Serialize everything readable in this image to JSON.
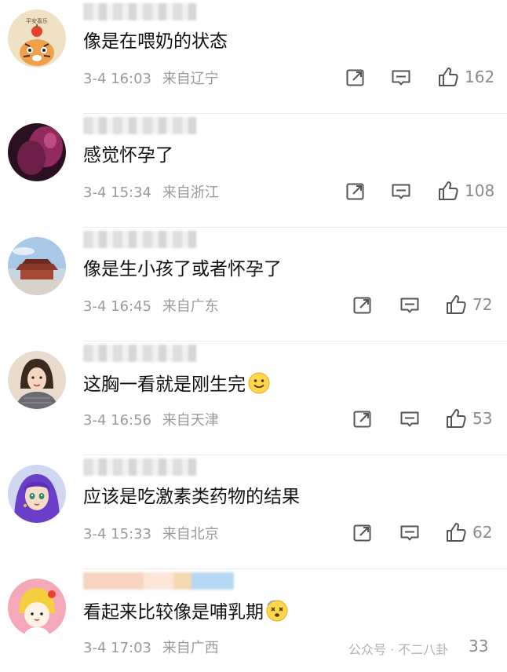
{
  "comments": [
    {
      "text": "像是在喂奶的状态",
      "date": "3-4",
      "time": "16:03",
      "location": "来自辽宁",
      "likes": "162",
      "avatar": "tiger-avatar"
    },
    {
      "text": "感觉怀孕了",
      "date": "3-4",
      "time": "15:34",
      "location": "来自浙江",
      "likes": "108",
      "avatar": "purple-avatar"
    },
    {
      "text": "像是生小孩了或者怀孕了",
      "date": "3-4",
      "time": "16:45",
      "location": "来自广东",
      "likes": "72",
      "avatar": "palace-avatar"
    },
    {
      "text": "这胸一看就是刚生完",
      "date": "3-4",
      "time": "16:56",
      "location": "来自天津",
      "likes": "53",
      "avatar": "woman-avatar",
      "emoji": "slightly-smiling-emoji"
    },
    {
      "text": "应该是吃激素类药物的结果",
      "date": "3-4",
      "time": "15:33",
      "location": "来自北京",
      "likes": "62",
      "avatar": "anime-girl-avatar"
    },
    {
      "text": "看起来比较像是哺乳期",
      "date": "3-4",
      "time": "17:03",
      "location": "来自广西",
      "likes": "33",
      "avatar": "cartoon-kid-avatar",
      "emoji": "dizzy-face-emoji"
    }
  ],
  "avatar_text": {
    "tiger_caption": "平安喜乐"
  },
  "watermark": "公众号 · 不二八卦",
  "icons": {
    "forward": "forward-icon",
    "comment": "comment-icon",
    "like": "like-icon"
  },
  "colors": {
    "meta": "#9a9a9a",
    "text": "#111111",
    "divider": "#ececec"
  }
}
